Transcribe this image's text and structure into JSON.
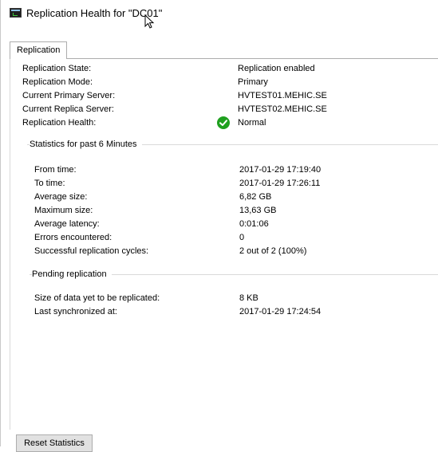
{
  "window": {
    "title": "Replication Health for \"DC01\"",
    "icon": "hyper-v-manager-icon"
  },
  "tabs": [
    {
      "label": "Replication",
      "selected": true
    }
  ],
  "summary": [
    {
      "label": "Replication State:",
      "value": "Replication enabled"
    },
    {
      "label": "Replication Mode:",
      "value": "Primary"
    },
    {
      "label": "Current Primary Server:",
      "value": "HVTEST01.MEHIC.SE"
    },
    {
      "label": "Current Replica Server:",
      "value": "HVTEST02.MEHIC.SE"
    },
    {
      "label": "Replication Health:",
      "value": "Normal",
      "status_icon": "green-check-icon",
      "status_color": "#1fa01f"
    }
  ],
  "statistics": {
    "title": "Statistics for past 6 Minutes",
    "rows": [
      {
        "label": "From time:",
        "value": "2017-01-29 17:19:40"
      },
      {
        "label": "To time:",
        "value": "2017-01-29 17:26:11"
      },
      {
        "label": "Average size:",
        "value": "6,82 GB"
      },
      {
        "label": "Maximum size:",
        "value": "13,63 GB"
      },
      {
        "label": "Average latency:",
        "value": "0:01:06"
      },
      {
        "label": "Errors encountered:",
        "value": "0"
      },
      {
        "label": "Successful replication cycles:",
        "value": "2 out of 2 (100%)"
      }
    ]
  },
  "pending": {
    "title": "Pending replication",
    "rows": [
      {
        "label": "Size of data yet to be replicated:",
        "value": "8 KB"
      },
      {
        "label": "Last synchronized at:",
        "value": "2017-01-29 17:24:54"
      }
    ]
  },
  "buttons": {
    "reset_statistics": "Reset Statistics"
  }
}
